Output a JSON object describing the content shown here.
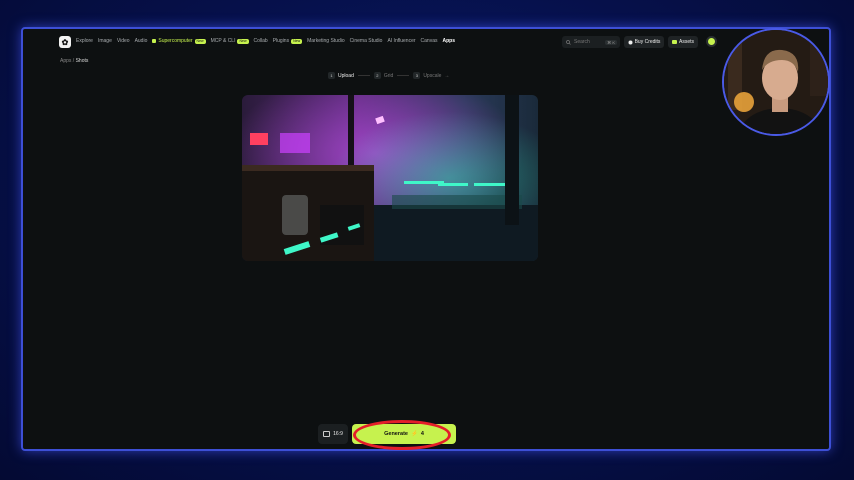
{
  "nav": {
    "logo_glyph": "✿",
    "links": [
      {
        "label": "Explore",
        "badge": ""
      },
      {
        "label": "Image",
        "badge": ""
      },
      {
        "label": "Video",
        "badge": ""
      },
      {
        "label": "Audio",
        "badge": ""
      },
      {
        "label": "Supercomputer",
        "badge": "New"
      },
      {
        "label": "MCP & CLI",
        "badge": "New"
      },
      {
        "label": "Collab",
        "badge": ""
      },
      {
        "label": "Plugins",
        "badge": "New"
      },
      {
        "label": "Marketing Studio",
        "badge": ""
      },
      {
        "label": "Cinema Studio",
        "badge": ""
      },
      {
        "label": "AI Influencer",
        "badge": ""
      },
      {
        "label": "Canvas",
        "badge": ""
      },
      {
        "label": "Apps",
        "badge": ""
      }
    ],
    "search_placeholder": "Search",
    "search_shortcut": "⌘ K",
    "buy_credits_label": "Buy Credits",
    "assets_label": "Assets"
  },
  "breadcrumb": {
    "parent": "Apps",
    "separator": "/",
    "current": "Shots"
  },
  "steps": [
    {
      "num": "1",
      "label": "Upload"
    },
    {
      "num": "2",
      "label": "Grid"
    },
    {
      "num": "3",
      "label": "Upscale"
    }
  ],
  "bottom": {
    "aspect_ratio": "16:9",
    "generate_label": "Generate",
    "generate_cost": "4"
  },
  "colors": {
    "accent": "#c6f24e",
    "frame_border": "#3d4fd6",
    "annotation": "#e41e2a"
  }
}
